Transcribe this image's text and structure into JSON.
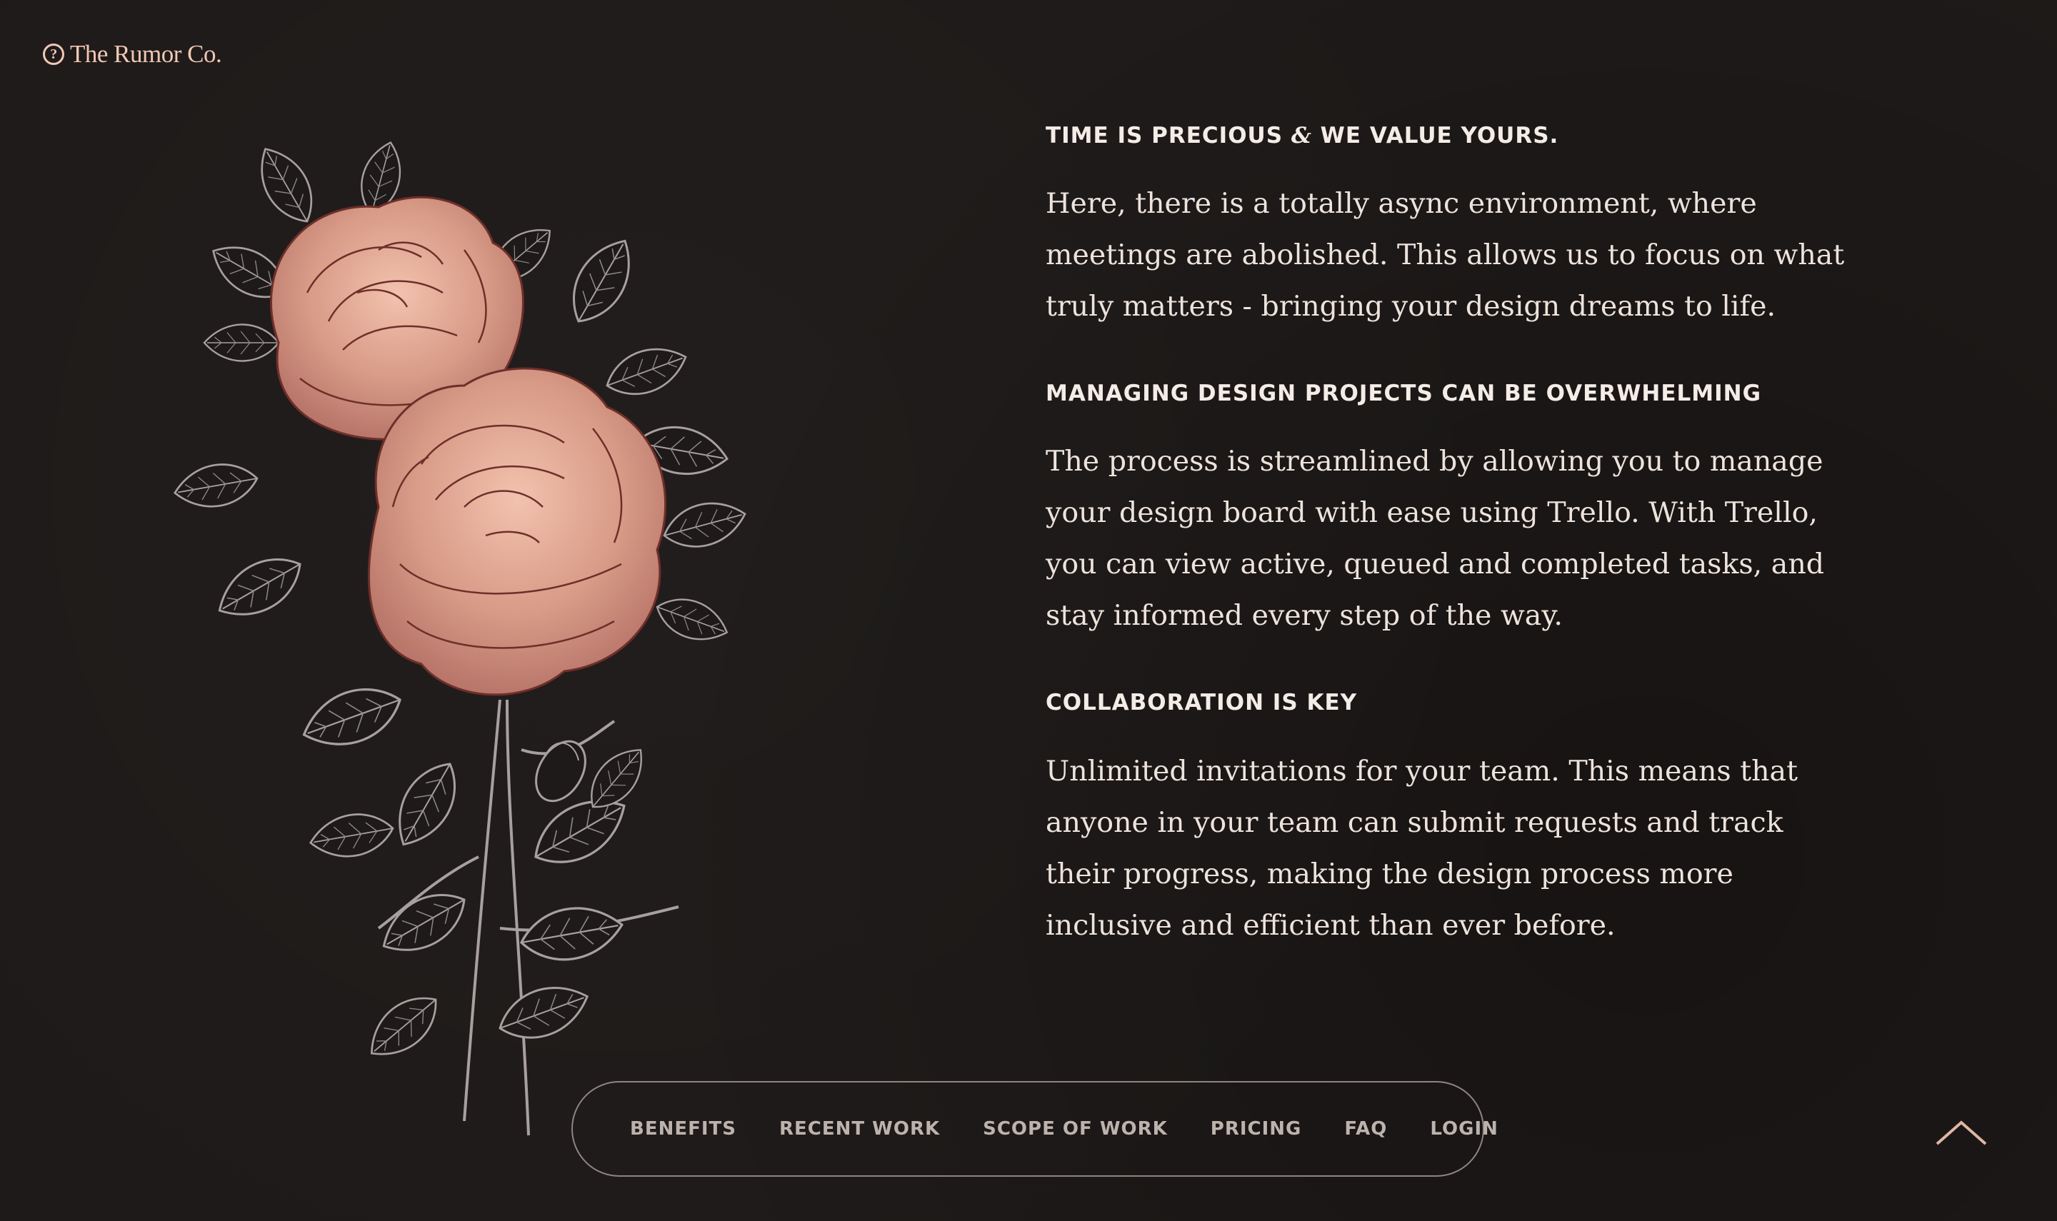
{
  "brand": {
    "logo_mark": "?",
    "name": "The Rumor Co."
  },
  "sections": [
    {
      "heading_pre": "TIME IS PRECIOUS ",
      "heading_amp": "&",
      "heading_post": " WE VALUE YOURS.",
      "body": "Here, there is a totally async environment, where meetings are abolished. This allows us to focus on what truly matters - bringing your design dreams to life."
    },
    {
      "heading": "MANAGING DESIGN PROJECTS CAN BE OVERWHELMING",
      "body": "The process is streamlined by allowing you to manage your design board with ease using Trello. With Trello, you can view active, queued and completed tasks, and stay informed every step of the way."
    },
    {
      "heading": "COLLABORATION IS KEY",
      "body": "Unlimited invitations for your team. This means that anyone in your team can submit requests and track their progress, making the design process more inclusive and efficient than ever before."
    }
  ],
  "nav": {
    "items": [
      "BENEFITS",
      "RECENT WORK",
      "SCOPE OF WORK",
      "PRICING",
      "FAQ",
      "LOGIN"
    ]
  },
  "icons": {
    "illustration": "rose-bouquet-illustration",
    "back_to_top": "chevron-up-icon"
  },
  "colors": {
    "background": "#1e1a19",
    "accent": "#f0c8b4",
    "rose": "#d99a86",
    "text": "#ede3dc",
    "nav_text": "#bdb3ad",
    "nav_border": "#8d8583"
  }
}
